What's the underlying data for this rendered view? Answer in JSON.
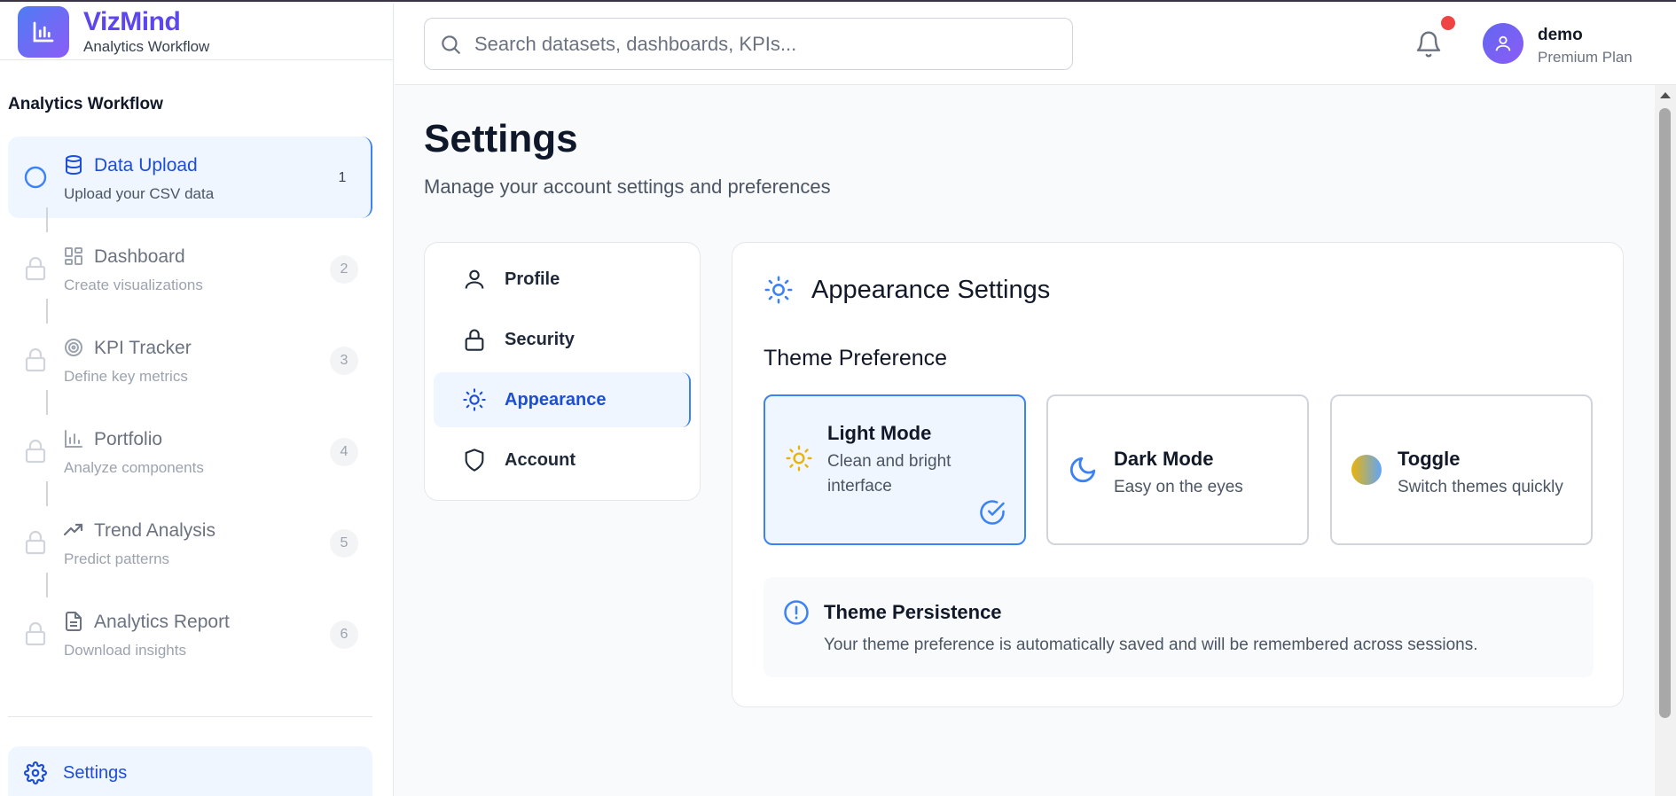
{
  "brand": {
    "name": "VizMind",
    "subtitle": "Analytics Workflow"
  },
  "sidebar": {
    "section_title": "Analytics Workflow",
    "steps": [
      {
        "title": "Data Upload",
        "description": "Upload your CSV data",
        "number": "1",
        "icon": "database-icon",
        "status": "active"
      },
      {
        "title": "Dashboard",
        "description": "Create visualizations",
        "number": "2",
        "icon": "grid-icon",
        "status": "locked"
      },
      {
        "title": "KPI Tracker",
        "description": "Define key metrics",
        "number": "3",
        "icon": "target-icon",
        "status": "locked"
      },
      {
        "title": "Portfolio",
        "description": "Analyze components",
        "number": "4",
        "icon": "bar-chart-icon",
        "status": "locked"
      },
      {
        "title": "Trend Analysis",
        "description": "Predict patterns",
        "number": "5",
        "icon": "trending-up-icon",
        "status": "locked"
      },
      {
        "title": "Analytics Report",
        "description": "Download insights",
        "number": "6",
        "icon": "file-text-icon",
        "status": "locked"
      }
    ],
    "settings_label": "Settings"
  },
  "topbar": {
    "search_placeholder": "Search datasets, dashboards, KPIs...",
    "user_name": "demo",
    "user_plan": "Premium Plan",
    "has_notification": true
  },
  "page": {
    "title": "Settings",
    "subtitle": "Manage your account settings and preferences"
  },
  "settings_tabs": [
    {
      "label": "Profile",
      "icon": "user-icon",
      "active": false
    },
    {
      "label": "Security",
      "icon": "lock-icon",
      "active": false
    },
    {
      "label": "Appearance",
      "icon": "sun-icon",
      "active": true
    },
    {
      "label": "Account",
      "icon": "shield-icon",
      "active": false
    }
  ],
  "appearance": {
    "title": "Appearance Settings",
    "theme_label": "Theme Preference",
    "themes": [
      {
        "title": "Light Mode",
        "description": "Clean and bright interface",
        "icon": "sun-icon",
        "selected": true
      },
      {
        "title": "Dark Mode",
        "description": "Easy on the eyes",
        "icon": "moon-icon",
        "selected": false
      },
      {
        "title": "Toggle",
        "description": "Switch themes quickly",
        "icon": "gradient-circle-icon",
        "selected": false
      }
    ],
    "persistence": {
      "title": "Theme Persistence",
      "text": "Your theme preference is automatically saved and will be remembered across sessions."
    }
  },
  "colors": {
    "accent": "#3b82f6",
    "accent_dark": "#1d4ed8",
    "brand": "#5b46f0",
    "notification": "#ef4444",
    "sun": "#eab308"
  }
}
